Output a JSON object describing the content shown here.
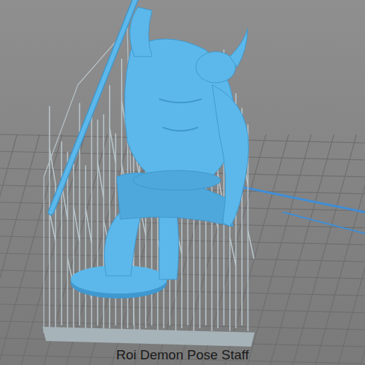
{
  "caption": "Roi Demon Pose Staff"
}
